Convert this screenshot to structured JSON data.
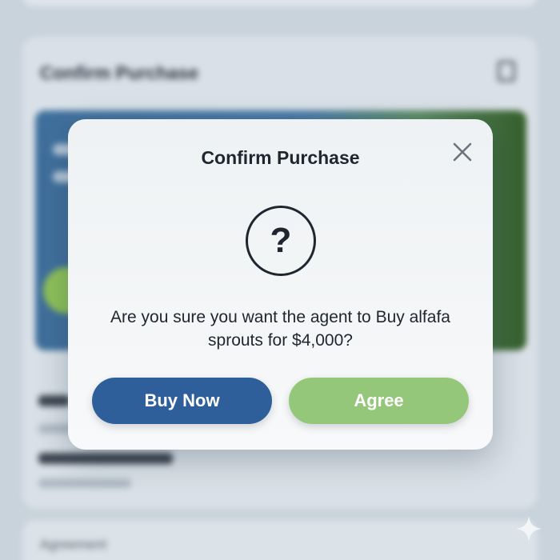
{
  "background": {
    "card_title": "Confirm Purchase",
    "bottom_text": "Agreement"
  },
  "dialog": {
    "title": "Confirm Purchase",
    "message": "Are you sure you want the agent to Buy alfafa sprouts for $4,000?",
    "buttons": {
      "buy_now": "Buy Now",
      "agree": "Agree"
    }
  },
  "icons": {
    "close": "close-icon",
    "question": "question-icon",
    "trash": "trash-icon",
    "sparkle": "sparkle-icon"
  },
  "colors": {
    "buy_now_button": "#2f5f9a",
    "agree_button": "#94c77a",
    "text": "#1f2630"
  }
}
